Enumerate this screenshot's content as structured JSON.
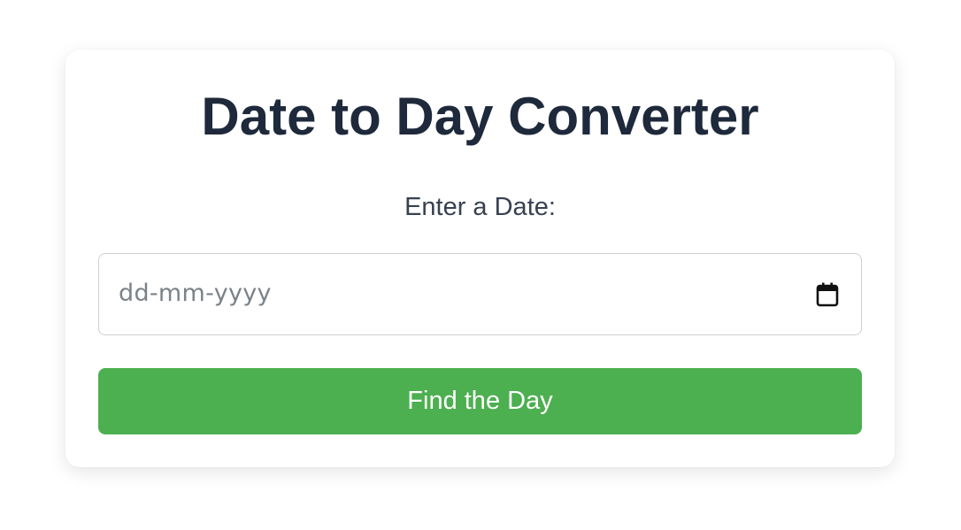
{
  "card": {
    "title": "Date to Day Converter",
    "date_label": "Enter a Date:",
    "date_input": {
      "placeholder": "dd-mm-yyyy",
      "value": "",
      "picker_icon": "calendar-icon"
    },
    "submit_label": "Find the Day"
  },
  "colors": {
    "title": "#1e293b",
    "label": "#374151",
    "button_bg": "#4caf50",
    "button_text": "#ffffff",
    "input_border": "#cfcfcf",
    "placeholder": "#7b8288"
  }
}
